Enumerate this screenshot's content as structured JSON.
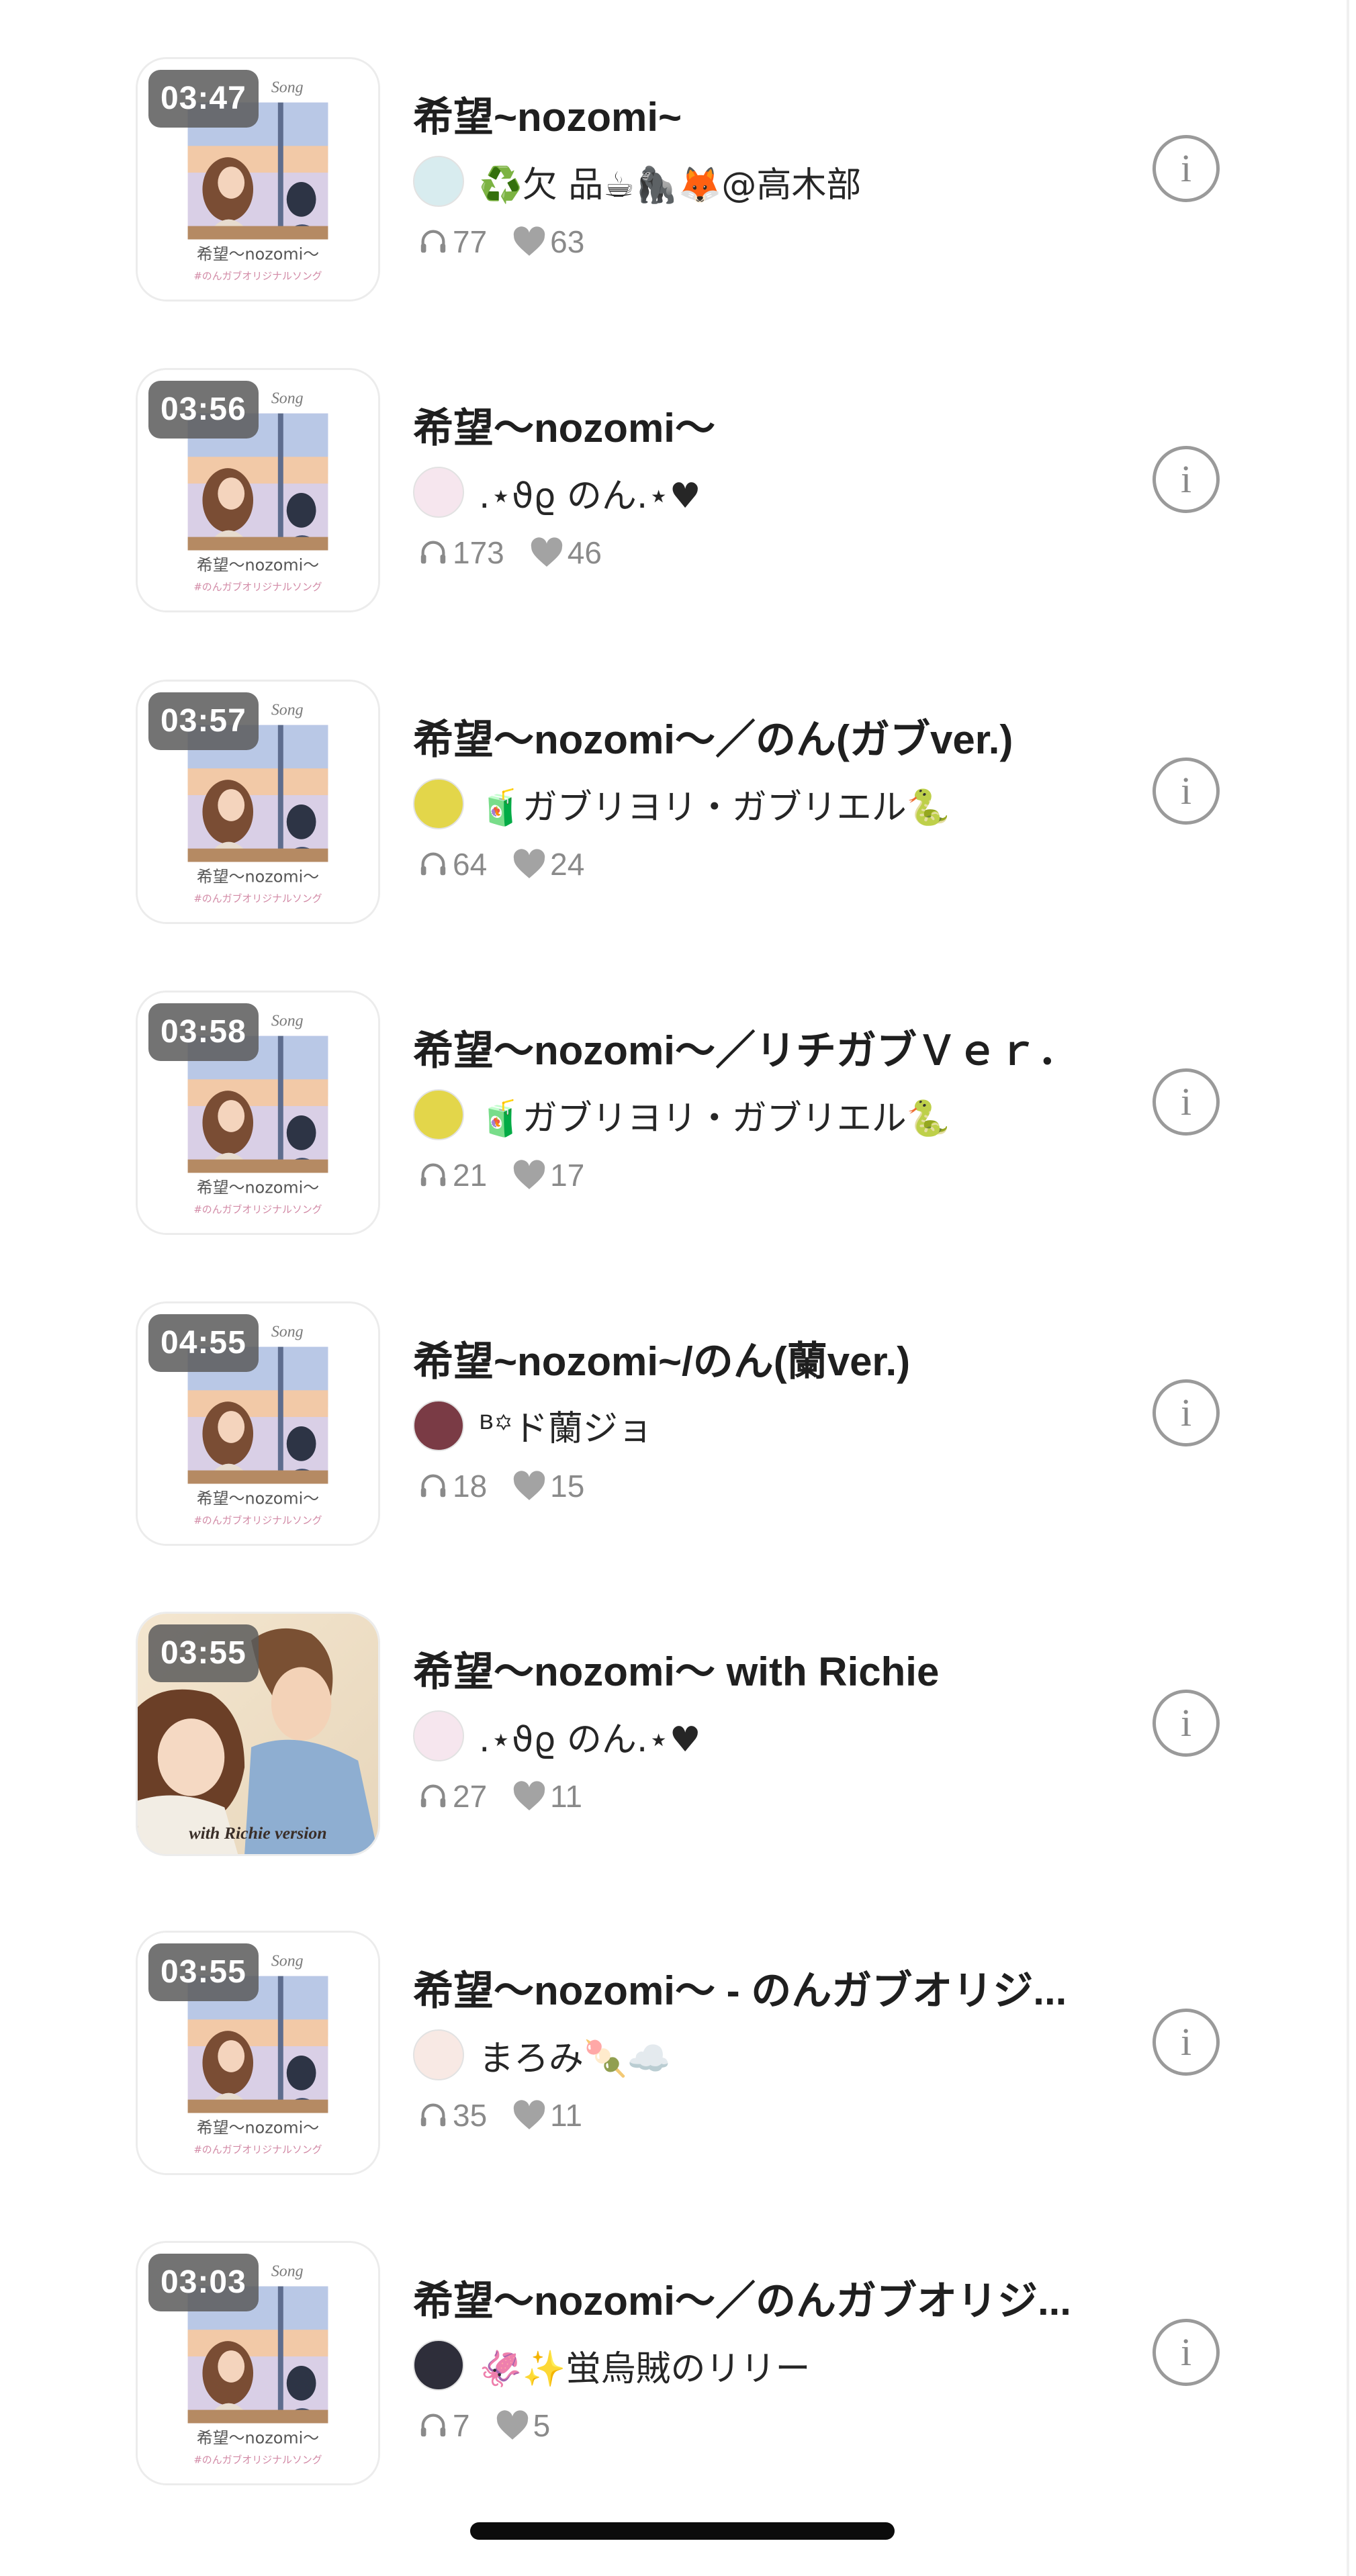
{
  "tracks": [
    {
      "duration": "03:47",
      "title": "希望~nozomi~",
      "user": "♻️欠 品☕🦍🦊@高木部",
      "plays": "77",
      "likes": "63",
      "art": "cover"
    },
    {
      "duration": "03:56",
      "title": "希望〜nozomi〜",
      "user": ".⋆ϑϱ のん.⋆♥",
      "plays": "173",
      "likes": "46",
      "art": "cover"
    },
    {
      "duration": "03:57",
      "title": "希望〜nozomi〜／のん(ガブver.)",
      "user": "🧃ガブリヨリ・ガブリエル🐍",
      "plays": "64",
      "likes": "24",
      "art": "cover"
    },
    {
      "duration": "03:58",
      "title": "希望〜nozomi〜／リチガブＶｅｒ．",
      "user": "🧃ガブリヨリ・ガブリエル🐍",
      "plays": "21",
      "likes": "17",
      "art": "cover"
    },
    {
      "duration": "04:55",
      "title": "希望~nozomi~/のん(蘭ver.)",
      "user": "ᴮ꙳ド蘭ジョ",
      "plays": "18",
      "likes": "15",
      "art": "cover"
    },
    {
      "duration": "03:55",
      "title": "希望〜nozomi〜 with Richie",
      "user": ".⋆ϑϱ のん.⋆♥",
      "plays": "27",
      "likes": "11",
      "art": "richie"
    },
    {
      "duration": "03:55",
      "title": "希望〜nozomi〜 - のんガブオリジ...",
      "user": "まろみ🍡☁️",
      "plays": "35",
      "likes": "11",
      "art": "cover"
    },
    {
      "duration": "03:03",
      "title": "希望〜nozomi〜／のんガブオリジ...",
      "user": "🦑✨蛍烏賊のリリー",
      "plays": "7",
      "likes": "5",
      "art": "cover"
    }
  ],
  "cover": {
    "caption": "希望〜nozomi〜",
    "sub_caption": "#のんガブオリジナルソング",
    "script_text": "Song"
  },
  "richie_cover": {
    "caption": "with Richie version"
  },
  "info_glyph": "i",
  "colors": {
    "accent_text": "#1f1f1f",
    "muted": "#8a8a8a",
    "badge": "#5a5a5a"
  }
}
